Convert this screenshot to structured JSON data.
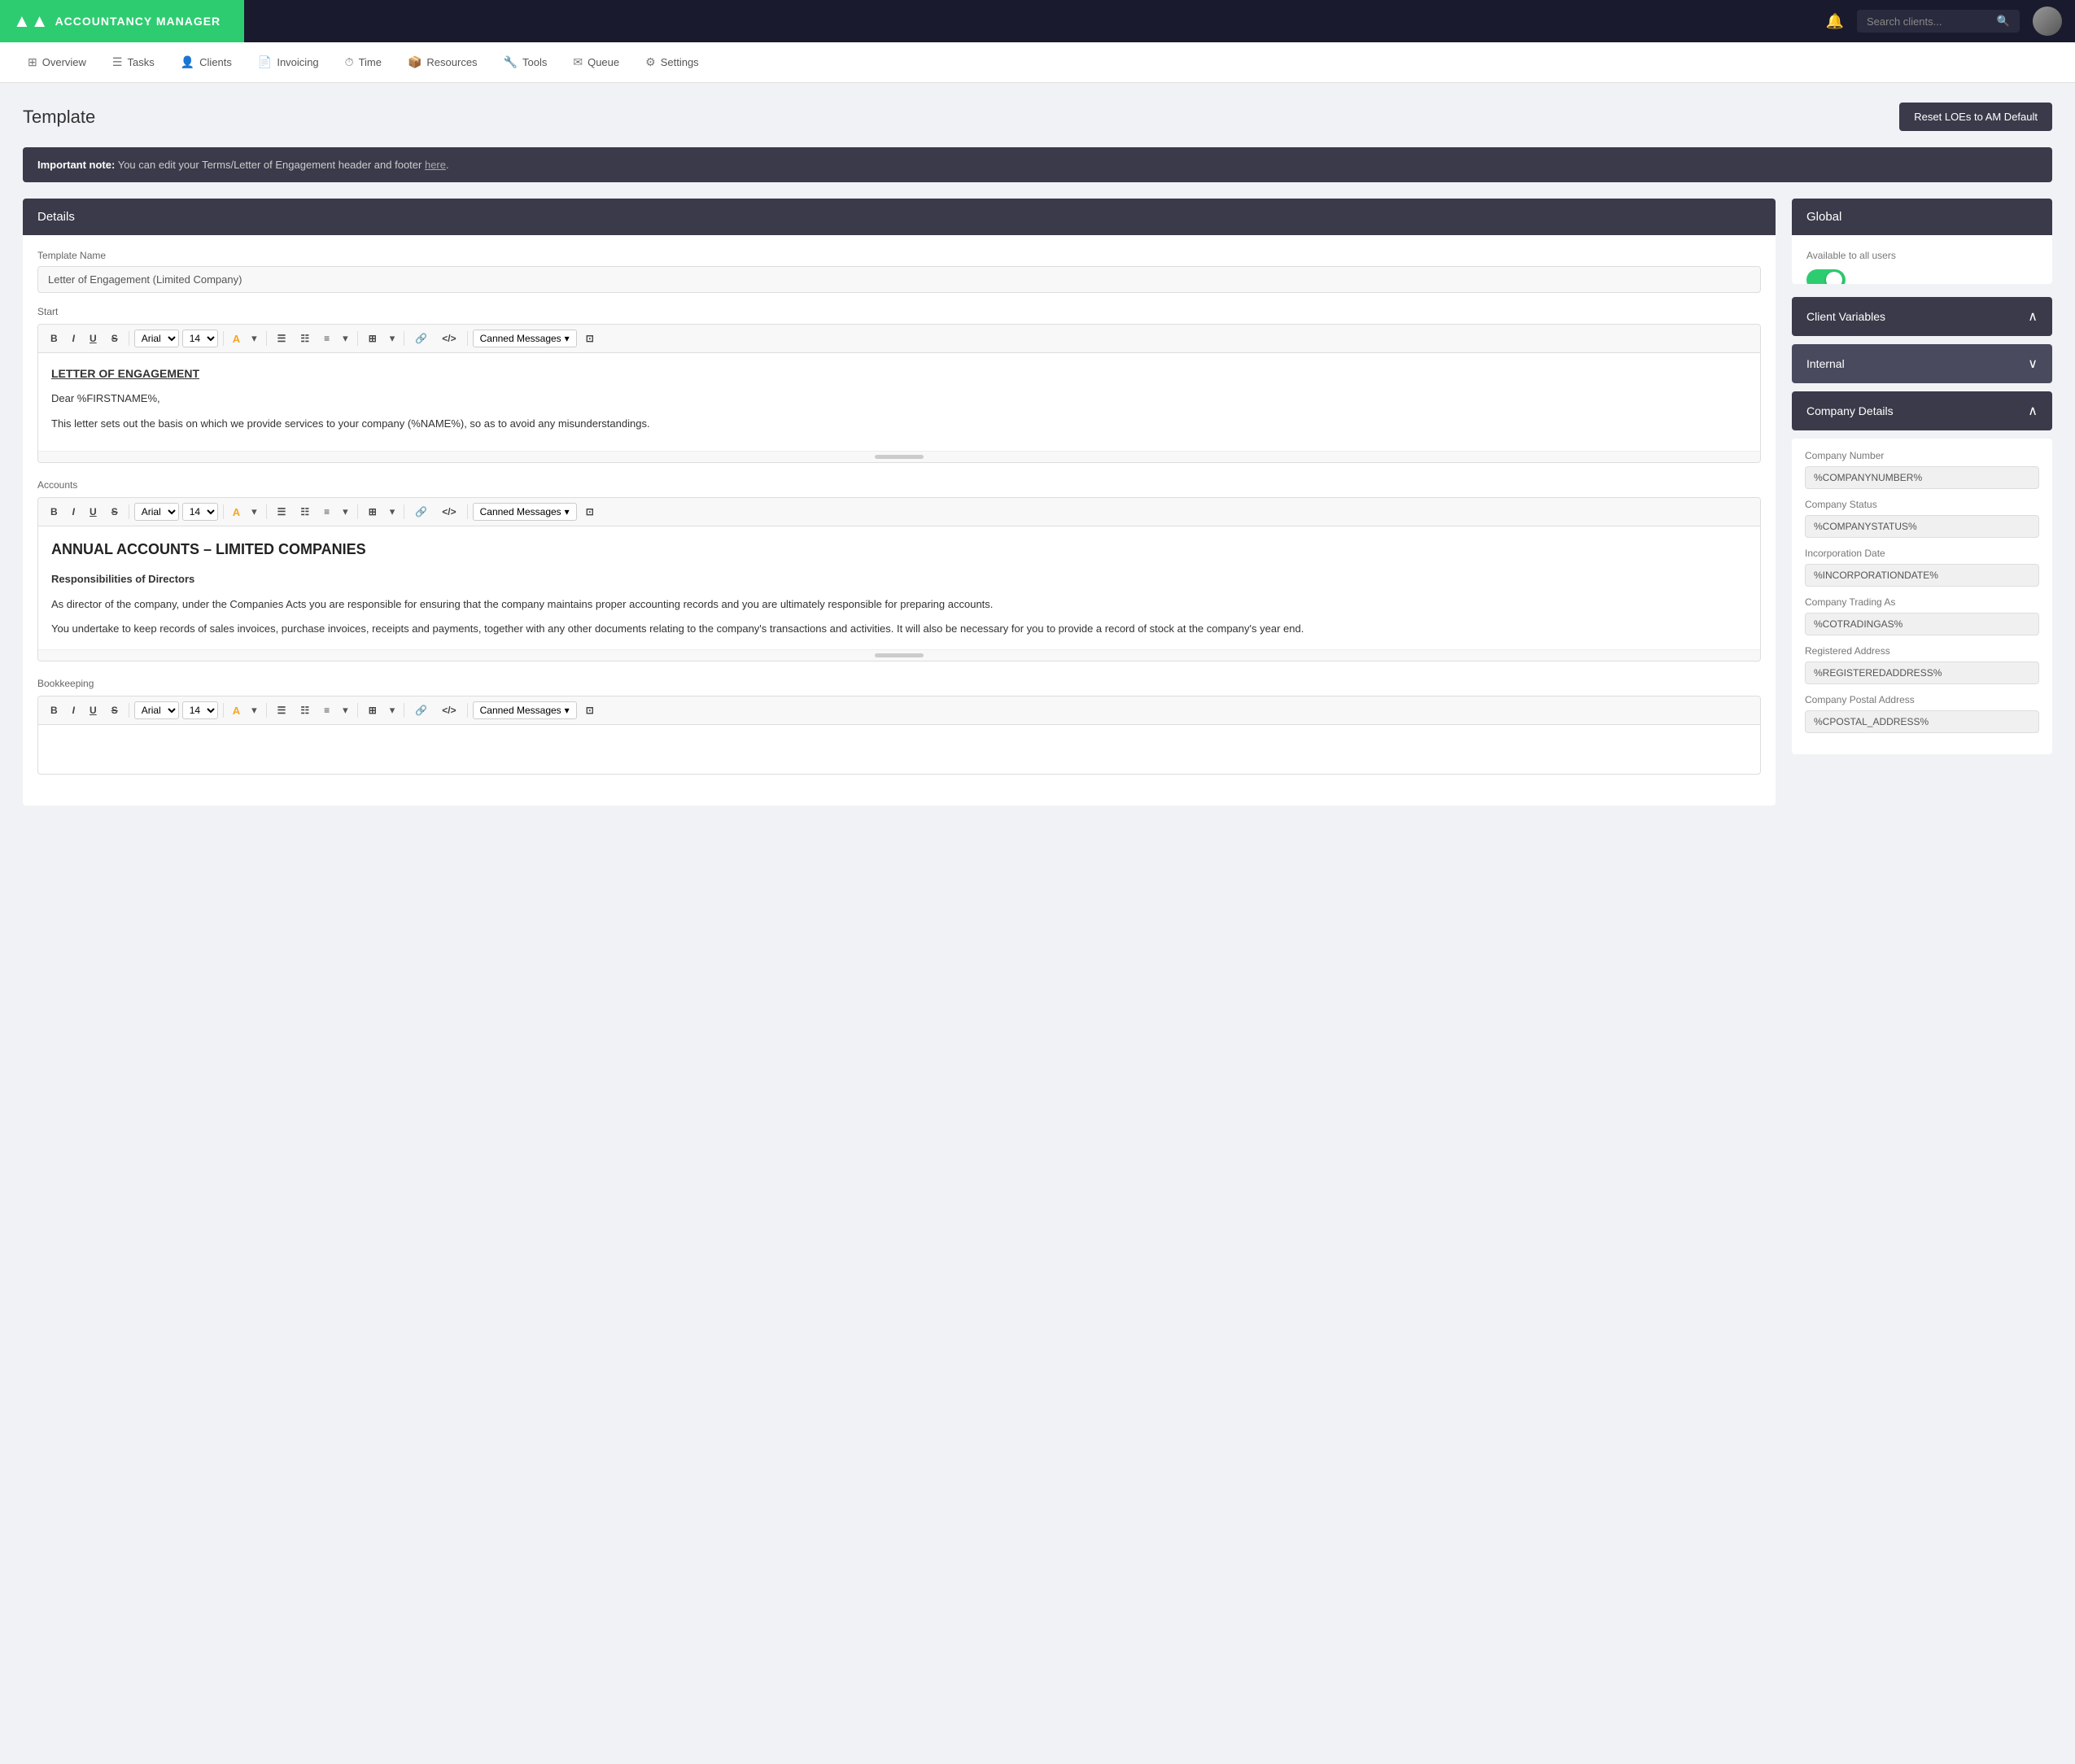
{
  "app": {
    "logo": "AM",
    "logo_full": "ACCOUNTANCY MANAGER",
    "search_placeholder": "Search clients..."
  },
  "nav": {
    "items": [
      {
        "label": "Overview",
        "icon": "⊞"
      },
      {
        "label": "Tasks",
        "icon": "☰"
      },
      {
        "label": "Clients",
        "icon": "👤"
      },
      {
        "label": "Invoicing",
        "icon": "📄"
      },
      {
        "label": "Time",
        "icon": "⏱"
      },
      {
        "label": "Resources",
        "icon": "📦"
      },
      {
        "label": "Tools",
        "icon": "🔧"
      },
      {
        "label": "Queue",
        "icon": "✉"
      },
      {
        "label": "Settings",
        "icon": "⚙"
      }
    ]
  },
  "page": {
    "title": "Template",
    "reset_btn": "Reset LOEs to AM Default"
  },
  "banner": {
    "prefix": "Important note:",
    "text": " You can edit your Terms/Letter of Engagement header and footer ",
    "link": "here"
  },
  "details_panel": {
    "header": "Details",
    "template_name_label": "Template Name",
    "template_name_value": "Letter of Engagement (Limited Company)"
  },
  "start_section": {
    "label": "Start",
    "toolbar": {
      "bold": "B",
      "italic": "I",
      "underline": "U",
      "strikethrough": "S̶",
      "font": "Arial",
      "size": "14",
      "highlight": "A",
      "highlight_arrow": "▾",
      "unordered": "☰",
      "ordered": "☷",
      "align": "≡",
      "align_arrow": "▾",
      "table": "⊞",
      "table_arrow": "▾",
      "link": "🔗",
      "code": "</>",
      "canned": "Canned Messages",
      "source": "⊡"
    },
    "content": {
      "heading": "LETTER OF ENGAGEMENT",
      "line1": "Dear %FIRSTNAME%,",
      "line2": "This letter sets out the basis on which we provide services to your company (%NAME%), so as to avoid any misunderstandings."
    }
  },
  "accounts_section": {
    "label": "Accounts",
    "content": {
      "heading": "ANNUAL ACCOUNTS – LIMITED COMPANIES",
      "subheading": "Responsibilities of Directors",
      "para1": "As director of the company, under the Companies Acts you are responsible for ensuring that the company maintains proper accounting records and you are ultimately responsible for preparing accounts.",
      "para2": "You undertake to keep records of sales invoices, purchase invoices, receipts and payments, together with any other documents relating to the company's transactions and activities. It will also be necessary for you to provide a record of stock at the company's year end."
    }
  },
  "bookkeeping_section": {
    "label": "Bookkeeping"
  },
  "global_panel": {
    "header": "Global",
    "toggle_label": "Available to all users",
    "toggle_state": true
  },
  "client_variables": {
    "header": "Client Variables",
    "expanded": true
  },
  "internal": {
    "header": "Internal",
    "expanded": true
  },
  "company_details": {
    "header": "Company Details",
    "expanded": true,
    "fields": [
      {
        "label": "Company Number",
        "value": "%COMPANYNUMBER%"
      },
      {
        "label": "Company Status",
        "value": "%COMPANYSTATUS%"
      },
      {
        "label": "Incorporation Date",
        "value": "%INCORPORATIONDATE%"
      },
      {
        "label": "Company Trading As",
        "value": "%COTRADINGAS%"
      },
      {
        "label": "Registered Address",
        "value": "%REGISTEREDADDRESS%"
      },
      {
        "label": "Company Postal Address",
        "value": "%CPOSTAL_ADDRESS%"
      }
    ]
  },
  "canned_messages": {
    "label": "Canned Messages"
  }
}
